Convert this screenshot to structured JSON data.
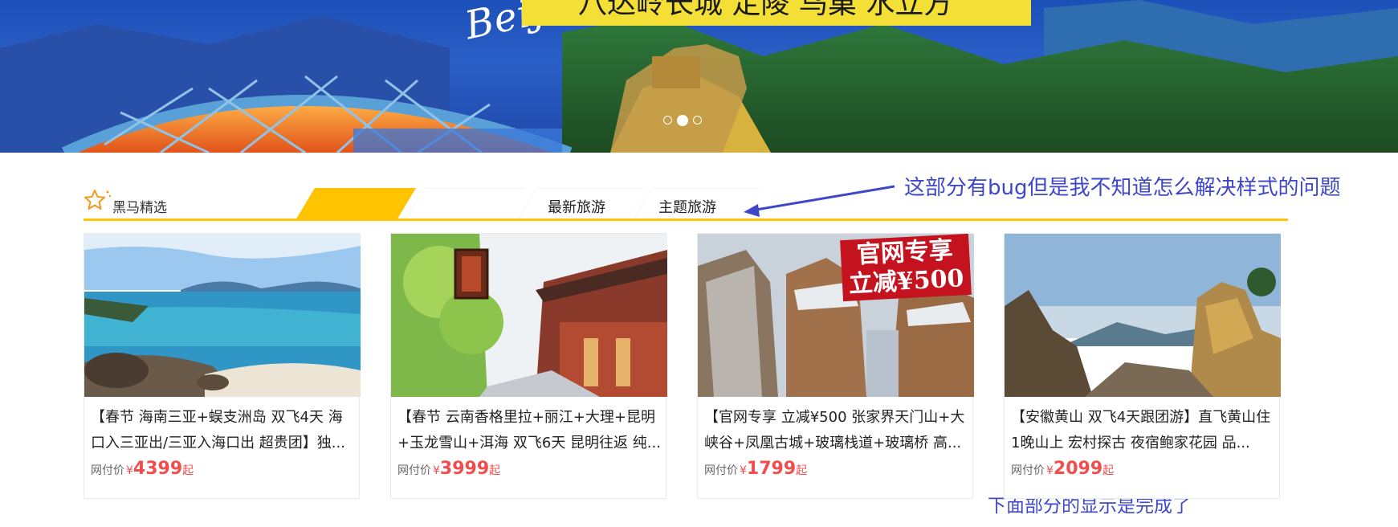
{
  "banner": {
    "caption": "八达岭长城  定陵  鸟巢  水立方",
    "script_text": "BeiJing",
    "dots": [
      false,
      true,
      false
    ]
  },
  "section": {
    "title": "黑马精选",
    "tabs": [
      {
        "label": ""
      },
      {
        "label": ""
      },
      {
        "label": "最新旅游"
      },
      {
        "label": "主题旅游"
      }
    ],
    "accent": "#ffc300"
  },
  "annotations": {
    "top": "这部分有bug但是我不知道怎么解决样式的问题",
    "bottom": "下面部分的显示是完成了",
    "color": "#3f47c9"
  },
  "cards": [
    {
      "title": "【春节 海南三亚+蜈支洲岛 双飞4天 海口入三亚出/三亚入海口出 超贵团】独...",
      "price_label": "网付价",
      "currency": "¥",
      "price": "4399",
      "suffix": "起"
    },
    {
      "title": "【春节 云南香格里拉+丽江+大理+昆明+玉龙雪山+洱海 双飞6天 昆明往返 纯...",
      "price_label": "网付价",
      "currency": "¥",
      "price": "3999",
      "suffix": "起"
    },
    {
      "title": "【官网专享 立减¥500 张家界天门山+大峡谷+凤凰古城+玻璃栈道+玻璃桥 高...",
      "price_label": "网付价",
      "currency": "¥",
      "price": "1799",
      "suffix": "起",
      "badge_line1": "官网专享",
      "badge_line2": "立减¥500"
    },
    {
      "title": "【安徽黄山 双飞4天跟团游】直飞黄山住1晚山上 宏村探古 夜宿鲍家花园 品...",
      "price_label": "网付价",
      "currency": "¥",
      "price": "2099",
      "suffix": "起"
    }
  ],
  "colors": {
    "price": "#f04e4e"
  }
}
